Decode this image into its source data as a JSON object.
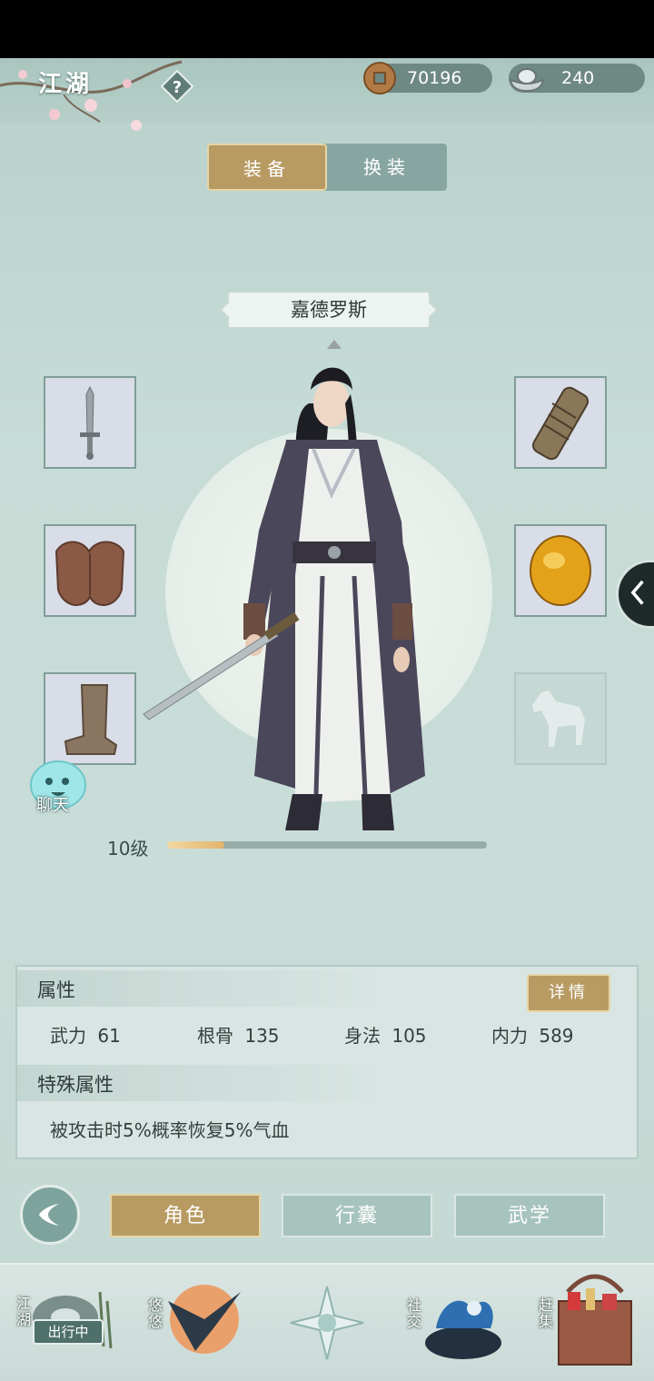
{
  "header": {
    "title": "江湖",
    "currency": [
      {
        "icon": "copper-coin-icon",
        "value": "70196"
      },
      {
        "icon": "silver-ingot-icon",
        "value": "240"
      }
    ]
  },
  "tabs": {
    "equip": "装备",
    "outfit": "换装"
  },
  "character": {
    "name": "嘉德罗斯",
    "level": "10级",
    "level_progress": 0.18
  },
  "equipment": {
    "left": [
      "sword-icon",
      "armor-icon",
      "boots-icon"
    ],
    "right": [
      "bracer-icon",
      "amber-jade-icon",
      "horse-icon"
    ]
  },
  "chat": {
    "label": "聊天"
  },
  "attributes": {
    "title": "属性",
    "detail_button": "详情",
    "stats": [
      {
        "label": "武力",
        "value": "61"
      },
      {
        "label": "根骨",
        "value": "135"
      },
      {
        "label": "身法",
        "value": "105"
      },
      {
        "label": "内力",
        "value": "589"
      }
    ],
    "special_title": "特殊属性",
    "special_text": "被攻击时5%概率恢复5%气血"
  },
  "subnav": {
    "role": "角色",
    "bag": "行囊",
    "martial": "武学"
  },
  "bottomnav": {
    "jianghu": "江湖",
    "outing_badge": "出行中",
    "youyou": "悠悠",
    "social": "社交",
    "market": "赶集"
  }
}
